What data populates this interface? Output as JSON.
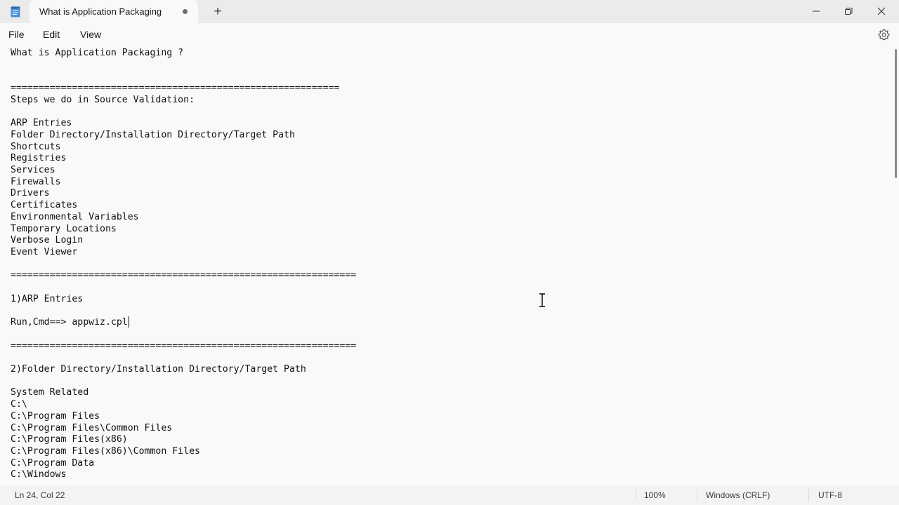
{
  "window": {
    "tab_title": "What is Application Packaging",
    "new_tab_symbol": "+",
    "icons": {
      "app": "notepad-icon",
      "unsaved": "unsaved-dot-icon",
      "minimize": "minimize-icon",
      "maximize": "restore-icon",
      "close": "close-icon"
    }
  },
  "menu": {
    "file": "File",
    "edit": "Edit",
    "view": "View",
    "settings_icon": "gear-icon"
  },
  "editor": {
    "content": "What is Application Packaging ?\n\n\n===========================================================\nSteps we do in Source Validation:\n\nARP Entries\nFolder Directory/Installation Directory/Target Path\nShortcuts\nRegistries\nServices\nFirewalls\nDrivers\nCertificates\nEnvironmental Variables\nTemporary Locations\nVerbose Login\nEvent Viewer\n\n==============================================================\n\n1)ARP Entries\n\nRun,Cmd==> appwiz.cpl\n\n==============================================================\n\n2)Folder Directory/Installation Directory/Target Path\n\nSystem Related\nC:\\\nC:\\Program Files\nC:\\Program Files\\Common Files\nC:\\Program Files(x86)\nC:\\Program Files(x86)\\Common Files\nC:\\Program Data\nC:\\Windows"
  },
  "status": {
    "position": "Ln 24, Col 22",
    "zoom": "100%",
    "line_ending": "Windows (CRLF)",
    "encoding": "UTF-8"
  },
  "colors": {
    "titlebar_bg": "#ebebeb",
    "editor_bg": "#f9f9f9",
    "statusbar_bg": "#f3f3f3",
    "text": "#111111"
  }
}
